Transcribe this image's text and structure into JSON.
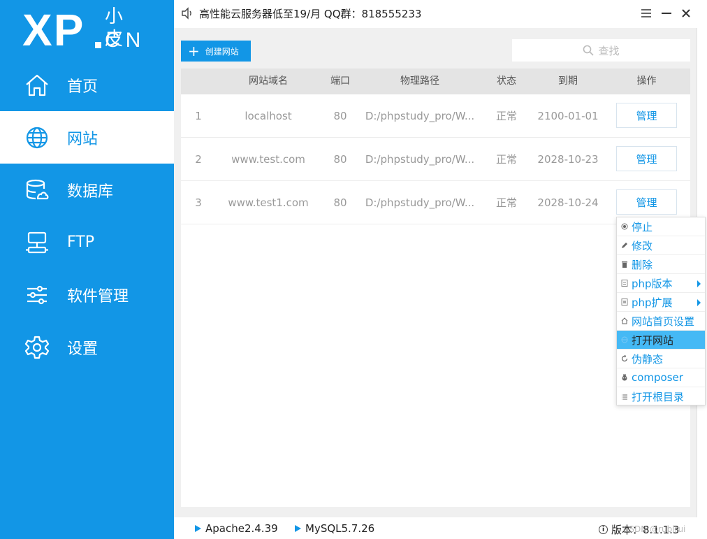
{
  "logo": {
    "xp": "XP",
    "cn_zh": "小皮",
    "cn_en": "CN"
  },
  "nav": {
    "items": [
      {
        "label": "首页"
      },
      {
        "label": "网站"
      },
      {
        "label": "数据库"
      },
      {
        "label": "FTP"
      },
      {
        "label": "软件管理"
      },
      {
        "label": "设置"
      }
    ]
  },
  "topbar": {
    "notice": "高性能云服务器低至19/月  QQ群：818555233"
  },
  "toolbar": {
    "create_label": "创建网站",
    "search_placeholder": "查找"
  },
  "table": {
    "headers": [
      "网站域名",
      "端口",
      "物理路径",
      "状态",
      "到期",
      "操作"
    ],
    "rows": [
      {
        "index": "1",
        "domain": "localhost",
        "port": "80",
        "path": "D:/phpstudy_pro/W...",
        "status": "正常",
        "expire": "2100-01-01",
        "action": "管理"
      },
      {
        "index": "2",
        "domain": "www.test.com",
        "port": "80",
        "path": "D:/phpstudy_pro/W...",
        "status": "正常",
        "expire": "2028-10-23",
        "action": "管理"
      },
      {
        "index": "3",
        "domain": "www.test1.com",
        "port": "80",
        "path": "D:/phpstudy_pro/W...",
        "status": "正常",
        "expire": "2028-10-24",
        "action": "管理"
      }
    ]
  },
  "context_menu": {
    "items": [
      {
        "label": "停止"
      },
      {
        "label": "修改"
      },
      {
        "label": "删除"
      },
      {
        "label": "php版本"
      },
      {
        "label": "php扩展"
      },
      {
        "label": "网站首页设置"
      },
      {
        "label": "打开网站"
      },
      {
        "label": "伪静态"
      },
      {
        "label": "composer"
      },
      {
        "label": "打开根目录"
      }
    ]
  },
  "status": {
    "apache": "Apache2.4.39",
    "mysql": "MySQL5.7.26",
    "version": "版本：8.1.1.3",
    "watermark": "CSDN @rubirui"
  },
  "colors": {
    "accent": "#1296e6",
    "highlight": "#45b9f5",
    "panel_bg": "#f0f0f0"
  }
}
